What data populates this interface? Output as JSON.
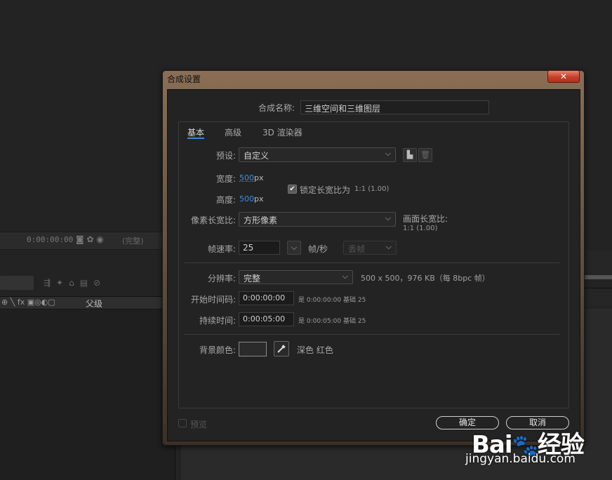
{
  "background_app": {
    "timecode": "0:00:00:00",
    "complete_badge": "(完整)",
    "column_header_icons": "⊕ ╲ fx ▣◎◐▢",
    "parent_column": "父级"
  },
  "dialog": {
    "title": "合成设置",
    "close_icon": "close-icon",
    "comp_name_label": "合成名称:",
    "comp_name_value": "三维空间和三维图层",
    "tabs": [
      {
        "label": "基本"
      },
      {
        "label": "高级"
      },
      {
        "label": "3D 渲染器"
      }
    ],
    "preset": {
      "label": "预设:",
      "value": "自定义"
    },
    "width": {
      "label": "宽度:",
      "value": "500",
      "unit": "px"
    },
    "height": {
      "label": "高度:",
      "value": "500",
      "unit": "px"
    },
    "lock_aspect": {
      "label": "锁定长宽比为",
      "ratio": "1:1 (1.00)",
      "checked": true
    },
    "pixel_aspect": {
      "label": "像素长宽比:",
      "value": "方形像素"
    },
    "frame_aspect": {
      "label": "画面长宽比:",
      "value": "1:1 (1.00)"
    },
    "frame_rate": {
      "label": "帧速率:",
      "value": "25",
      "unit": "帧/秒",
      "drop_frame": "丢帧"
    },
    "resolution": {
      "label": "分辨率:",
      "value": "完整",
      "info": "500 x 500，976 KB（每 8bpc 帧）"
    },
    "start_timecode": {
      "label": "开始时间码:",
      "value": "0:00:00:00",
      "is_text": "是 0:00:00:00",
      "base_text": "基础 25"
    },
    "duration": {
      "label": "持续时间:",
      "value": "0:00:05:00",
      "is_text": "是 0:00:05:00",
      "base_text": "基础 25"
    },
    "background_color": {
      "label": "背景颜色:",
      "name": "深色 红色",
      "swatch": "#2b2b2b"
    },
    "preview_label": "预览",
    "ok_label": "确定",
    "cancel_label": "取消"
  },
  "watermark": {
    "logo": "Bai du 经验",
    "url": "jingyan.baidu.com"
  },
  "colors": {
    "accent_blue": "#3c8ee8",
    "title_bar_top": "#8a6e55",
    "close_red": "#c5402b",
    "panel_bg": "#232323"
  }
}
